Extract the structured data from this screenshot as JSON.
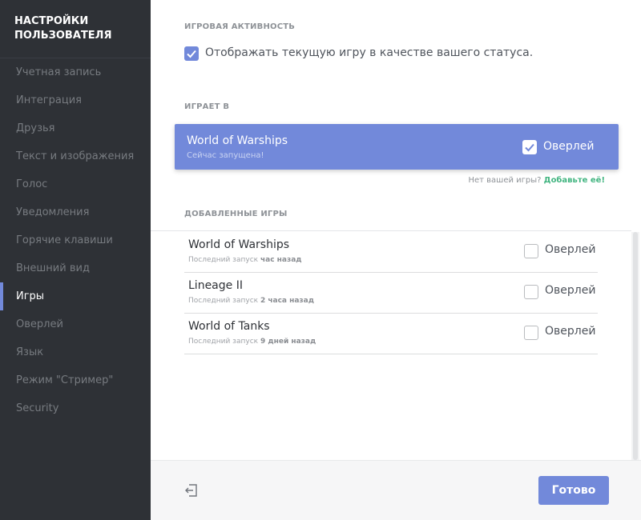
{
  "sidebar": {
    "title_line1": "НАСТРОЙКИ",
    "title_line2": "ПОЛЬЗОВАТЕЛЯ",
    "items": [
      {
        "label": "Учетная запись"
      },
      {
        "label": "Интеграция"
      },
      {
        "label": "Друзья"
      },
      {
        "label": "Текст и изображения"
      },
      {
        "label": "Голос"
      },
      {
        "label": "Уведомления"
      },
      {
        "label": "Горячие клавиши"
      },
      {
        "label": "Внешний вид"
      },
      {
        "label": "Игры"
      },
      {
        "label": "Оверлей"
      },
      {
        "label": "Язык"
      },
      {
        "label": "Режим \"Стример\""
      },
      {
        "label": "Security"
      }
    ],
    "active_item": "Игры"
  },
  "game_activity": {
    "section_label": "ИГРОВАЯ АКТИВНОСТЬ",
    "status_checkbox_label": "Отображать текущую игру в качестве вашего статуса.",
    "status_checked": true
  },
  "playing": {
    "section_label": "ИГРАЕТ В",
    "game_name": "World of Warships",
    "game_status": "Сейчас запущена!",
    "overlay_label": "Оверлей",
    "overlay_checked": true,
    "no_game_text": "Нет вашей игры?",
    "add_game_link": "Добавьте её!"
  },
  "added_games": {
    "section_label": "ДОБАВЛЕННЫЕ ИГРЫ",
    "games": [
      {
        "name": "World of Warships",
        "last_prefix": "Последний запуск",
        "last_value": "час назад",
        "overlay_label": "Оверлей",
        "overlay_checked": false
      },
      {
        "name": "Lineage II",
        "last_prefix": "Последний запуск",
        "last_value": "2 часа назад",
        "overlay_label": "Оверлей",
        "overlay_checked": false
      },
      {
        "name": "World of Tanks",
        "last_prefix": "Последний запуск",
        "last_value": "9 дней назад",
        "overlay_label": "Оверлей",
        "overlay_checked": false
      }
    ]
  },
  "footer": {
    "done_label": "Готово",
    "logout_icon": "logout-icon"
  },
  "colors": {
    "accent": "#7289da",
    "sidebar_bg": "#2e3136",
    "link_green": "#43b581"
  }
}
